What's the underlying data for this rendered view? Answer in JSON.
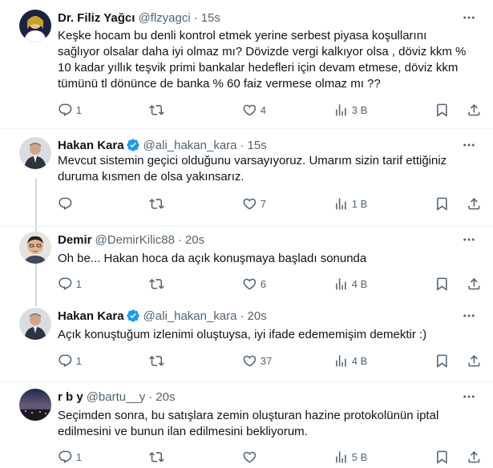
{
  "tweets": [
    {
      "name": "Dr. Filiz Yağcı",
      "handle": "@flzyagci",
      "time": "15s",
      "verified": false,
      "lines": [
        "Keşke hocam bu denli kontrol etmek yerine serbest piyasa koşullarını",
        "sağlıyor olsalar daha iyi olmaz mı? Dövizde vergi kalkıyor olsa , döviz kkm %",
        "10 kadar yıllık teşvik primi bankalar hedefleri için devam etmese, döviz kkm",
        "tümünü tl dönünce de banka % 60 faiz vermese olmaz mı ??"
      ],
      "replies": "1",
      "retweets": "",
      "likes": "4",
      "views": "3 B"
    },
    {
      "name": "Hakan Kara",
      "handle": "@ali_hakan_kara",
      "time": "15s",
      "verified": true,
      "lines": [
        "Mevcut sistemin geçici olduğunu varsayıyoruz. Umarım sizin tarif ettiğiniz",
        "duruma kısmen de olsa yakınsarız."
      ],
      "replies": "",
      "retweets": "",
      "likes": "7",
      "views": "1 B"
    },
    {
      "name": "Demir",
      "handle": "@DemirKilic88",
      "time": "20s",
      "verified": false,
      "lines": [
        "Oh be... Hakan hoca da açık konuşmaya başladı sonunda"
      ],
      "replies": "1",
      "retweets": "",
      "likes": "6",
      "views": "4 B"
    },
    {
      "name": "Hakan Kara",
      "handle": "@ali_hakan_kara",
      "time": "20s",
      "verified": true,
      "lines": [
        "Açık konuştuğum izlenimi oluştuysa, iyi ifade edememişim demektir :)"
      ],
      "replies": "1",
      "retweets": "",
      "likes": "37",
      "views": "4 B"
    },
    {
      "name": "r b y",
      "handle": "@bartu__y",
      "time": "20s",
      "verified": false,
      "lines": [
        "Seçimden sonra, bu satışlara zemin oluşturan hazine protokolünün iptal",
        "edilmesini ve bunun ilan edilmesini bekliyorum."
      ],
      "replies": "1",
      "retweets": "",
      "likes": "",
      "views": "5 B"
    }
  ],
  "dot": "·",
  "colors": {
    "verified": "#1d9bf0",
    "muted": "#536471",
    "text": "#0f1419",
    "divider": "#eff3f4",
    "thread": "#cfd9de"
  },
  "icons": [
    "more-icon",
    "reply-icon",
    "retweet-icon",
    "like-icon",
    "views-icon",
    "bookmark-icon",
    "share-icon",
    "verified-badge-icon"
  ]
}
